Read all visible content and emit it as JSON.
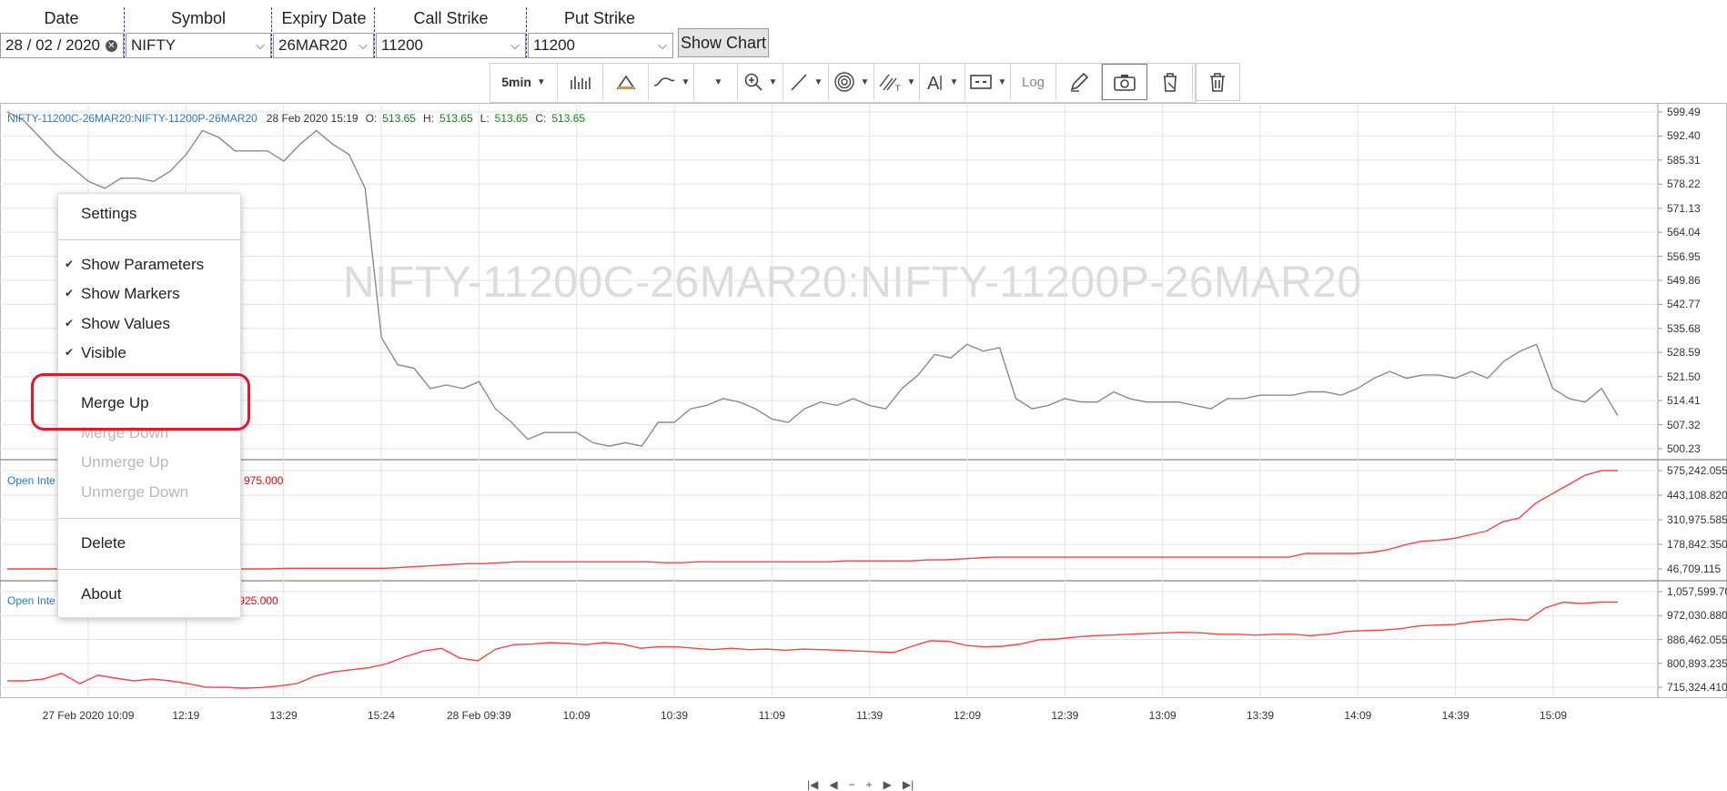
{
  "form": {
    "labels": {
      "date": "Date",
      "symbol": "Symbol",
      "expiry": "Expiry Date",
      "call": "Call Strike",
      "put": "Put Strike"
    },
    "date_value": "28 / 02 / 2020",
    "symbol_value": "NIFTY",
    "expiry_value": "26MAR20",
    "call_value": "11200",
    "put_value": "11200",
    "show_chart": "Show Chart"
  },
  "toolbar": {
    "interval": "5min",
    "log": "Log",
    "icons": [
      "bars-icon",
      "color-icon",
      "line-style-icon",
      "blank-select",
      "zoom-icon",
      "draw-line-icon",
      "fibonacci-icon",
      "channel-icon",
      "text-icon",
      "measure-icon",
      "log-button",
      "pencil-icon",
      "camera-icon",
      "clear-icon",
      "trash-icon"
    ]
  },
  "legend": {
    "symbol": "NIFTY-11200C-26MAR20:NIFTY-11200P-26MAR20",
    "datetime": "28 Feb 2020 15:19",
    "o_label": "O:",
    "o": "513.65",
    "h_label": "H:",
    "h": "513.65",
    "l_label": "L:",
    "l": "513.65",
    "c_label": "C:",
    "c": "513.65",
    "oi1_label": "Open Inte",
    "oi1_value": "975.000",
    "oi2_label": "Open Inte",
    "oi2_value": ",925.000"
  },
  "watermark": "NIFTY-11200C-26MAR20:NIFTY-11200P-26MAR20",
  "y_ticks_main": [
    "599.49",
    "592.40",
    "585.31",
    "578.22",
    "571.13",
    "564.04",
    "556.95",
    "549.86",
    "542.77",
    "535.68",
    "528.59",
    "521.50",
    "514.41",
    "507.32",
    "500.23"
  ],
  "y_ticks_oi1": [
    "575,242.055",
    "443,108.820",
    "310,975.585",
    "178,842.350",
    "46,709.115"
  ],
  "y_ticks_oi2": [
    "1,057,599.705",
    "972,030.880",
    "886,462.055",
    "800,893.235",
    "715,324.410"
  ],
  "x_ticks": [
    "27 Feb 2020 10:09",
    "12:19",
    "13:29",
    "15:24",
    "28 Feb 09:39",
    "10:09",
    "10:39",
    "11:09",
    "11:39",
    "12:09",
    "12:39",
    "13:09",
    "13:39",
    "14:09",
    "14:39",
    "15:09"
  ],
  "nav": [
    "|◀",
    "◀",
    "−",
    "+",
    "▶",
    "▶|"
  ],
  "menu": {
    "settings": "Settings",
    "show_parameters": "Show Parameters",
    "show_markers": "Show Markers",
    "show_values": "Show Values",
    "visible": "Visible",
    "merge_up": "Merge Up",
    "merge_down": "Merge Down",
    "unmerge_up": "Unmerge Up",
    "unmerge_down": "Unmerge Down",
    "delete": "Delete",
    "about": "About",
    "check": "✔"
  },
  "colors": {
    "price_line": "#8a8a8a",
    "oi_line": "#ff4040",
    "highlight": "#e0192b",
    "legend_symbol": "#2a78c8",
    "legend_value": "#0a8a0a"
  },
  "chart_data": [
    {
      "type": "line",
      "series": [
        {
          "values": [
            599.5,
            597,
            592,
            587,
            583,
            579,
            577,
            580,
            580,
            579,
            582,
            587,
            594,
            592,
            588,
            588,
            588,
            585,
            590,
            594,
            590,
            587,
            577,
            533,
            525,
            524,
            518,
            519,
            518,
            520,
            512,
            508,
            503,
            505,
            505,
            505,
            502,
            501,
            502,
            501,
            508,
            508,
            512,
            513,
            515,
            514,
            512,
            509,
            508,
            512,
            514,
            513,
            515,
            513,
            512,
            518,
            522,
            528,
            527,
            531,
            529,
            530,
            515,
            512,
            513,
            515,
            514,
            514,
            517,
            515,
            514,
            514,
            514,
            513,
            512,
            515,
            515,
            516,
            516,
            516,
            517,
            517,
            516,
            518,
            521,
            523,
            521,
            522,
            522,
            521,
            523,
            521,
            526,
            529,
            531,
            518,
            515,
            514,
            518,
            510
          ]
        }
      ],
      "ylim": [
        500.23,
        599.49
      ]
    },
    {
      "type": "line",
      "series": [
        {
          "values": [
            46709,
            46709,
            46709,
            46709,
            46709,
            46709,
            46709,
            46709,
            46709,
            46709,
            46709,
            46709,
            46709,
            46709,
            46709,
            46709,
            46709,
            50000,
            50000,
            50000,
            50000,
            50000,
            50000,
            50000,
            55000,
            60000,
            65000,
            70000,
            75000,
            75000,
            80000,
            85000,
            85000,
            85000,
            85000,
            85000,
            85000,
            85000,
            85000,
            85000,
            80000,
            80000,
            85000,
            85000,
            85000,
            85000,
            85000,
            85000,
            85000,
            85000,
            85000,
            90000,
            90000,
            90000,
            90000,
            90000,
            95000,
            95000,
            100000,
            105000,
            110000,
            110000,
            110000,
            110000,
            110000,
            110000,
            110000,
            110000,
            110000,
            110000,
            110000,
            110000,
            110000,
            110000,
            110000,
            110000,
            110000,
            110000,
            110000,
            130000,
            130000,
            130000,
            130000,
            135000,
            150000,
            175000,
            195000,
            200000,
            210000,
            230000,
            250000,
            300000,
            320000,
            400000,
            450000,
            500000,
            550000,
            575242,
            575242
          ]
        }
      ],
      "ylim": [
        46709.115,
        575242.055
      ]
    },
    {
      "type": "line",
      "series": [
        {
          "values": [
            738000,
            738000,
            745000,
            765000,
            728000,
            758000,
            748000,
            738000,
            745000,
            738000,
            728000,
            715000,
            715000,
            712000,
            714000,
            720000,
            728000,
            755000,
            770000,
            778000,
            785000,
            800000,
            825000,
            845000,
            855000,
            820000,
            810000,
            852000,
            868000,
            870000,
            875000,
            872000,
            868000,
            875000,
            870000,
            855000,
            860000,
            860000,
            855000,
            850000,
            855000,
            850000,
            852000,
            848000,
            852000,
            850000,
            848000,
            845000,
            842000,
            840000,
            862000,
            882000,
            880000,
            865000,
            860000,
            862000,
            870000,
            885000,
            888000,
            895000,
            900000,
            902000,
            905000,
            908000,
            910000,
            912000,
            910000,
            905000,
            905000,
            902000,
            905000,
            905000,
            900000,
            905000,
            915000,
            918000,
            920000,
            925000,
            935000,
            938000,
            940000,
            950000,
            955000,
            960000,
            955000,
            1000000,
            1020000,
            1015000,
            1020000,
            1020000
          ]
        }
      ],
      "ylim": [
        715324.41,
        1057599.705
      ]
    }
  ]
}
